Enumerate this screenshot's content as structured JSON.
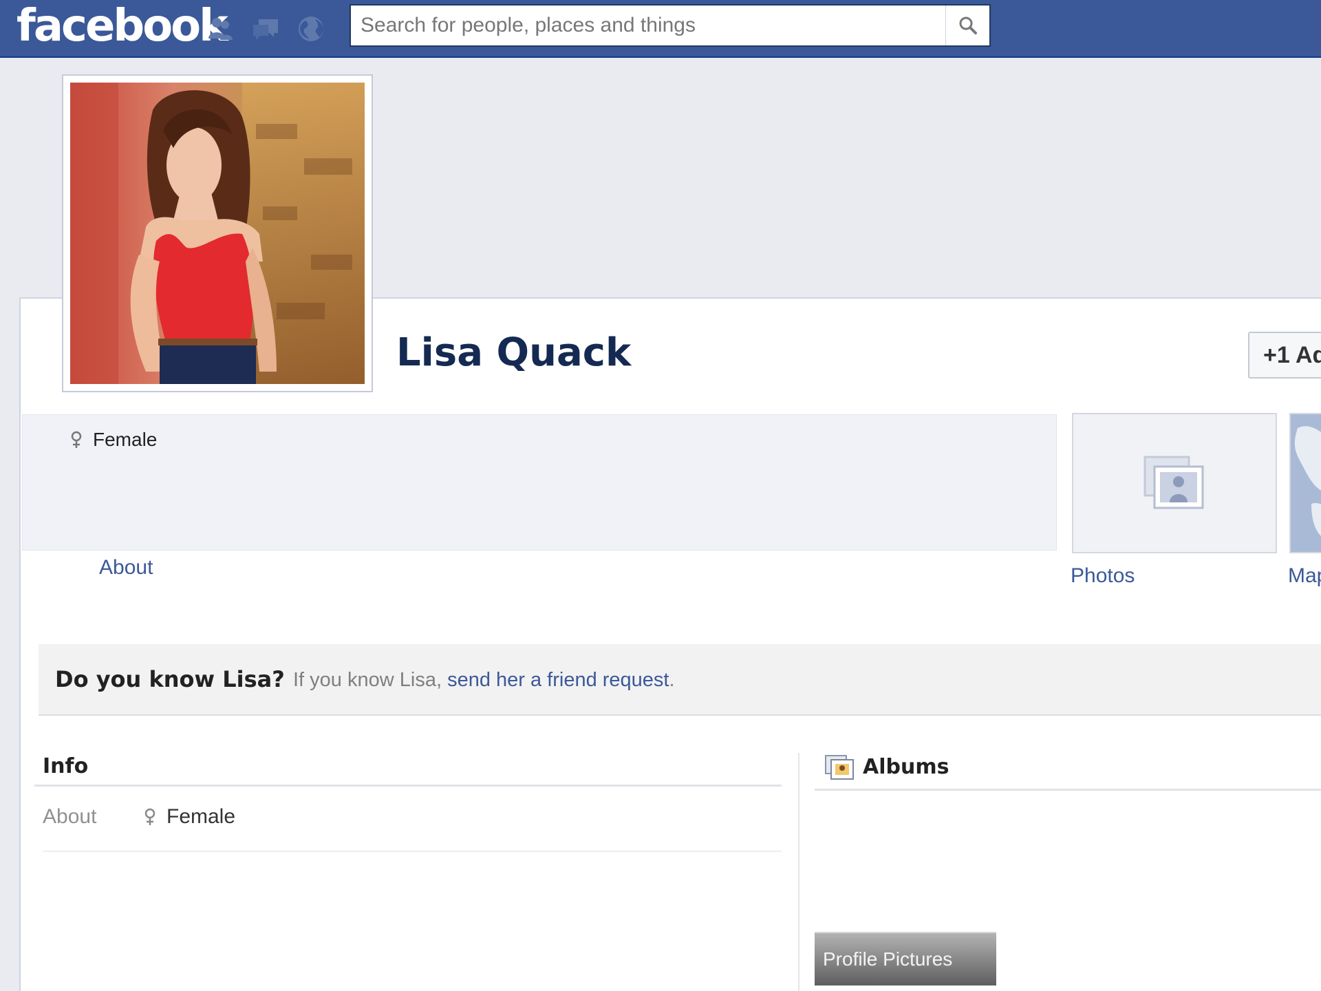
{
  "topbar": {
    "logo": "facebook",
    "jewels": [
      "friend-requests-icon",
      "messages-icon",
      "notifications-globe-icon"
    ],
    "search_placeholder": "Search for people, places and things",
    "colors": {
      "bar": "#3b5998",
      "border": "#133783"
    }
  },
  "profile": {
    "name": "Lisa Quack",
    "add_friend_label": "+1 Ad",
    "gender": "Female",
    "about_link": "About"
  },
  "tiles": [
    {
      "label": "Photos",
      "icon": "photos-icon"
    },
    {
      "label": "Map",
      "icon": "map-icon"
    }
  ],
  "know_bar": {
    "title": "Do you know Lisa?",
    "text": "If you know Lisa,",
    "link": "send her a friend request",
    "suffix": "."
  },
  "info": {
    "heading": "Info",
    "label": "About",
    "value": "Female"
  },
  "albums": {
    "heading": "Albums",
    "items": [
      {
        "label": "Profile Pictures"
      }
    ]
  }
}
